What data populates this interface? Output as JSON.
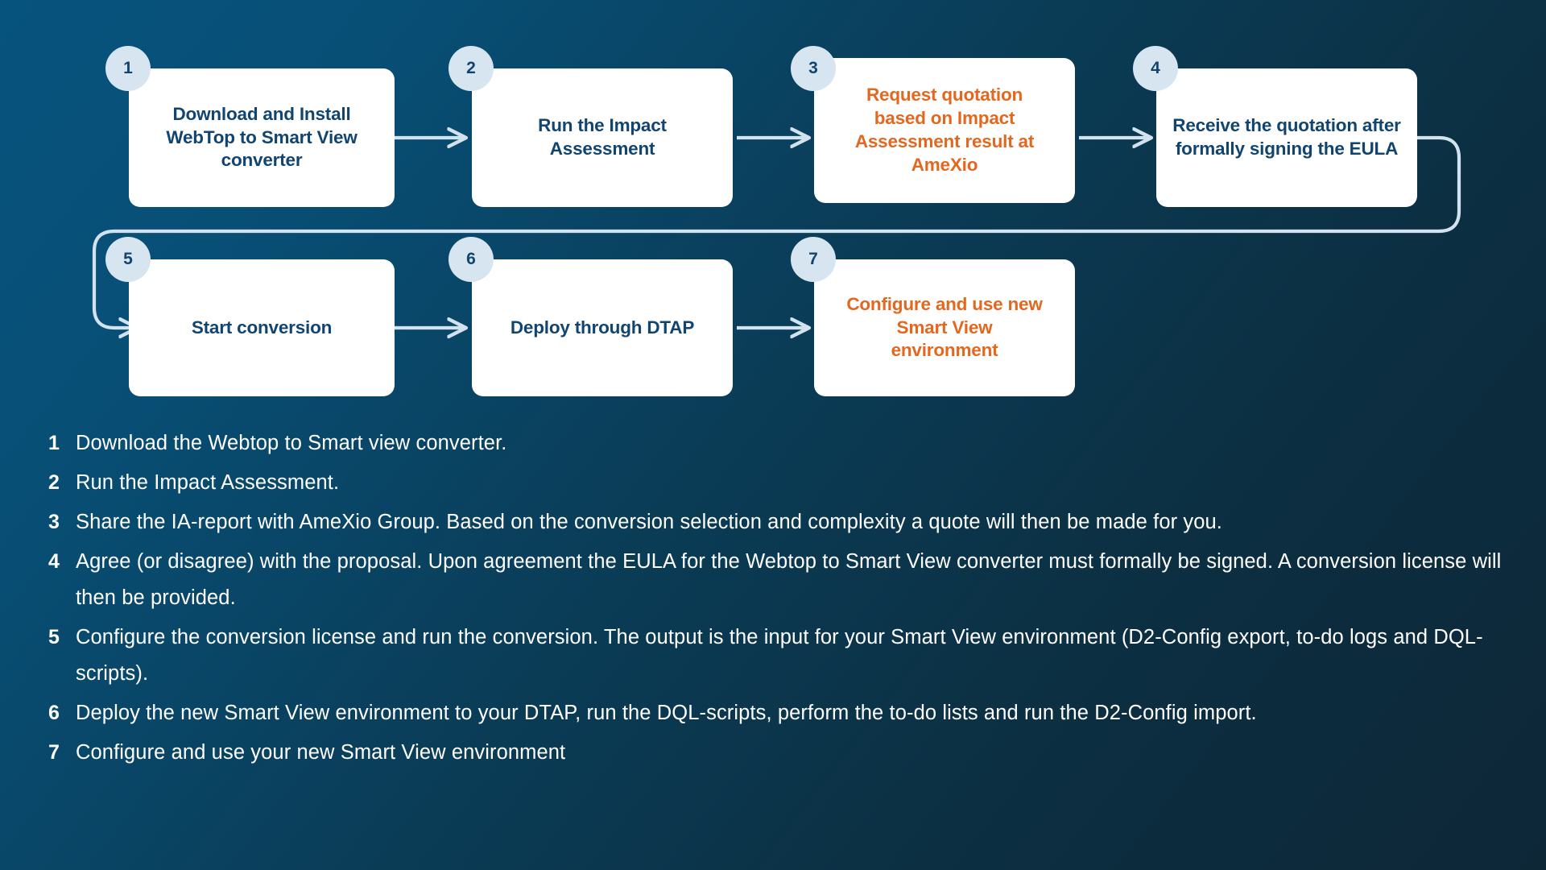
{
  "theme": {
    "background_top_left": "#06537E",
    "background_bottom_right": "#0D2737",
    "box_fill": "#FFFFFF",
    "navy_text": "#114570",
    "orange_text": "#E4671F",
    "badge_fill": "#D7E5F1",
    "connector": "#D3E2EF"
  },
  "flow": {
    "nodes": [
      {
        "number": "1",
        "label": "Download and Install WebTop to Smart View converter",
        "color": "navy"
      },
      {
        "number": "2",
        "label": "Run the Impact Assessment",
        "color": "navy"
      },
      {
        "number": "3",
        "label": "Request quotation based on Impact Assessment result at AmeXio",
        "color": "orange"
      },
      {
        "number": "4",
        "label": "Receive the quotation after formally signing the EULA",
        "color": "navy"
      },
      {
        "number": "5",
        "label": "Start conversion",
        "color": "navy"
      },
      {
        "number": "6",
        "label": "Deploy through DTAP",
        "color": "navy"
      },
      {
        "number": "7",
        "label": "Configure and use new Smart View environment",
        "color": "orange"
      }
    ]
  },
  "steps": [
    {
      "number": "1",
      "text": "Download the Webtop to Smart view converter."
    },
    {
      "number": "2",
      "text": "Run the Impact Assessment."
    },
    {
      "number": "3",
      "text": "Share the IA-report with AmeXio Group. Based on the conversion selection and complexity a quote will then be made for you."
    },
    {
      "number": "4",
      "text": "Agree (or disagree) with the proposal. Upon agreement the EULA for the Webtop to Smart View converter must formally be signed. A conversion license will then be provided."
    },
    {
      "number": "5",
      "text": "Configure the conversion license and run the conversion. The output is the input for your Smart View environment (D2-Config export, to-do logs and DQL-scripts)."
    },
    {
      "number": "6",
      "text": "Deploy the new Smart View environment to your DTAP, run the DQL-scripts, perform the to-do lists and run the D2-Config import."
    },
    {
      "number": "7",
      "text": "Configure and use your new Smart View environment"
    }
  ]
}
